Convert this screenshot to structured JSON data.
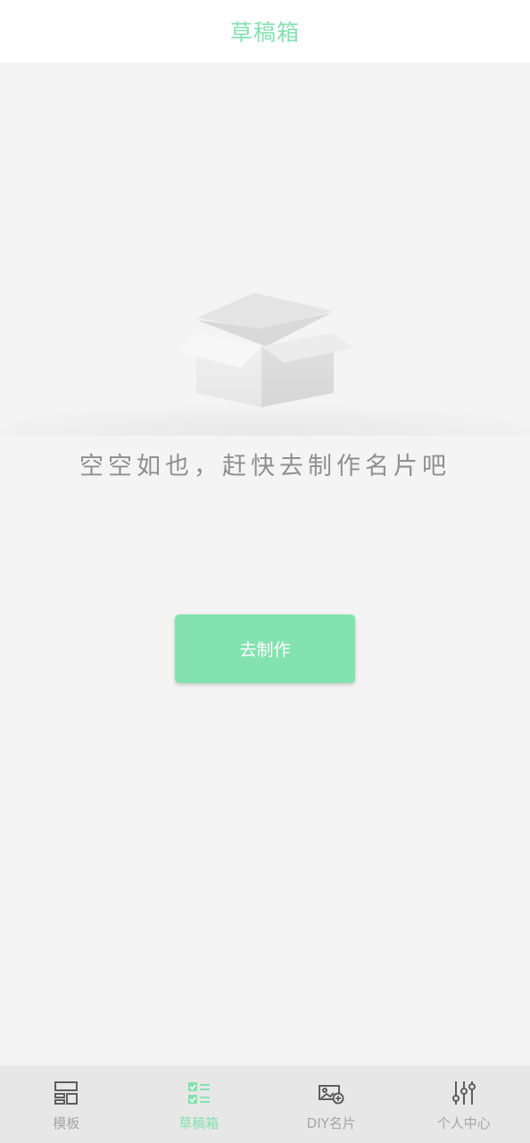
{
  "header": {
    "title": "草稿箱"
  },
  "empty_state": {
    "message": "空空如也，赶快去制作名片吧",
    "illustration_icon": "empty-box-icon"
  },
  "actions": {
    "make_label": "去制作"
  },
  "tabbar": {
    "items": [
      {
        "label": "模板",
        "icon": "template-icon",
        "active": false
      },
      {
        "label": "草稿箱",
        "icon": "drafts-icon",
        "active": true
      },
      {
        "label": "DIY名片",
        "icon": "diy-card-icon",
        "active": false
      },
      {
        "label": "个人中心",
        "icon": "settings-sliders-icon",
        "active": false
      }
    ]
  },
  "colors": {
    "accent": "#84e2b0",
    "background": "#f4f4f4",
    "tabbar_bg": "#e7e7e7",
    "inactive_text": "#a6a6a6"
  }
}
